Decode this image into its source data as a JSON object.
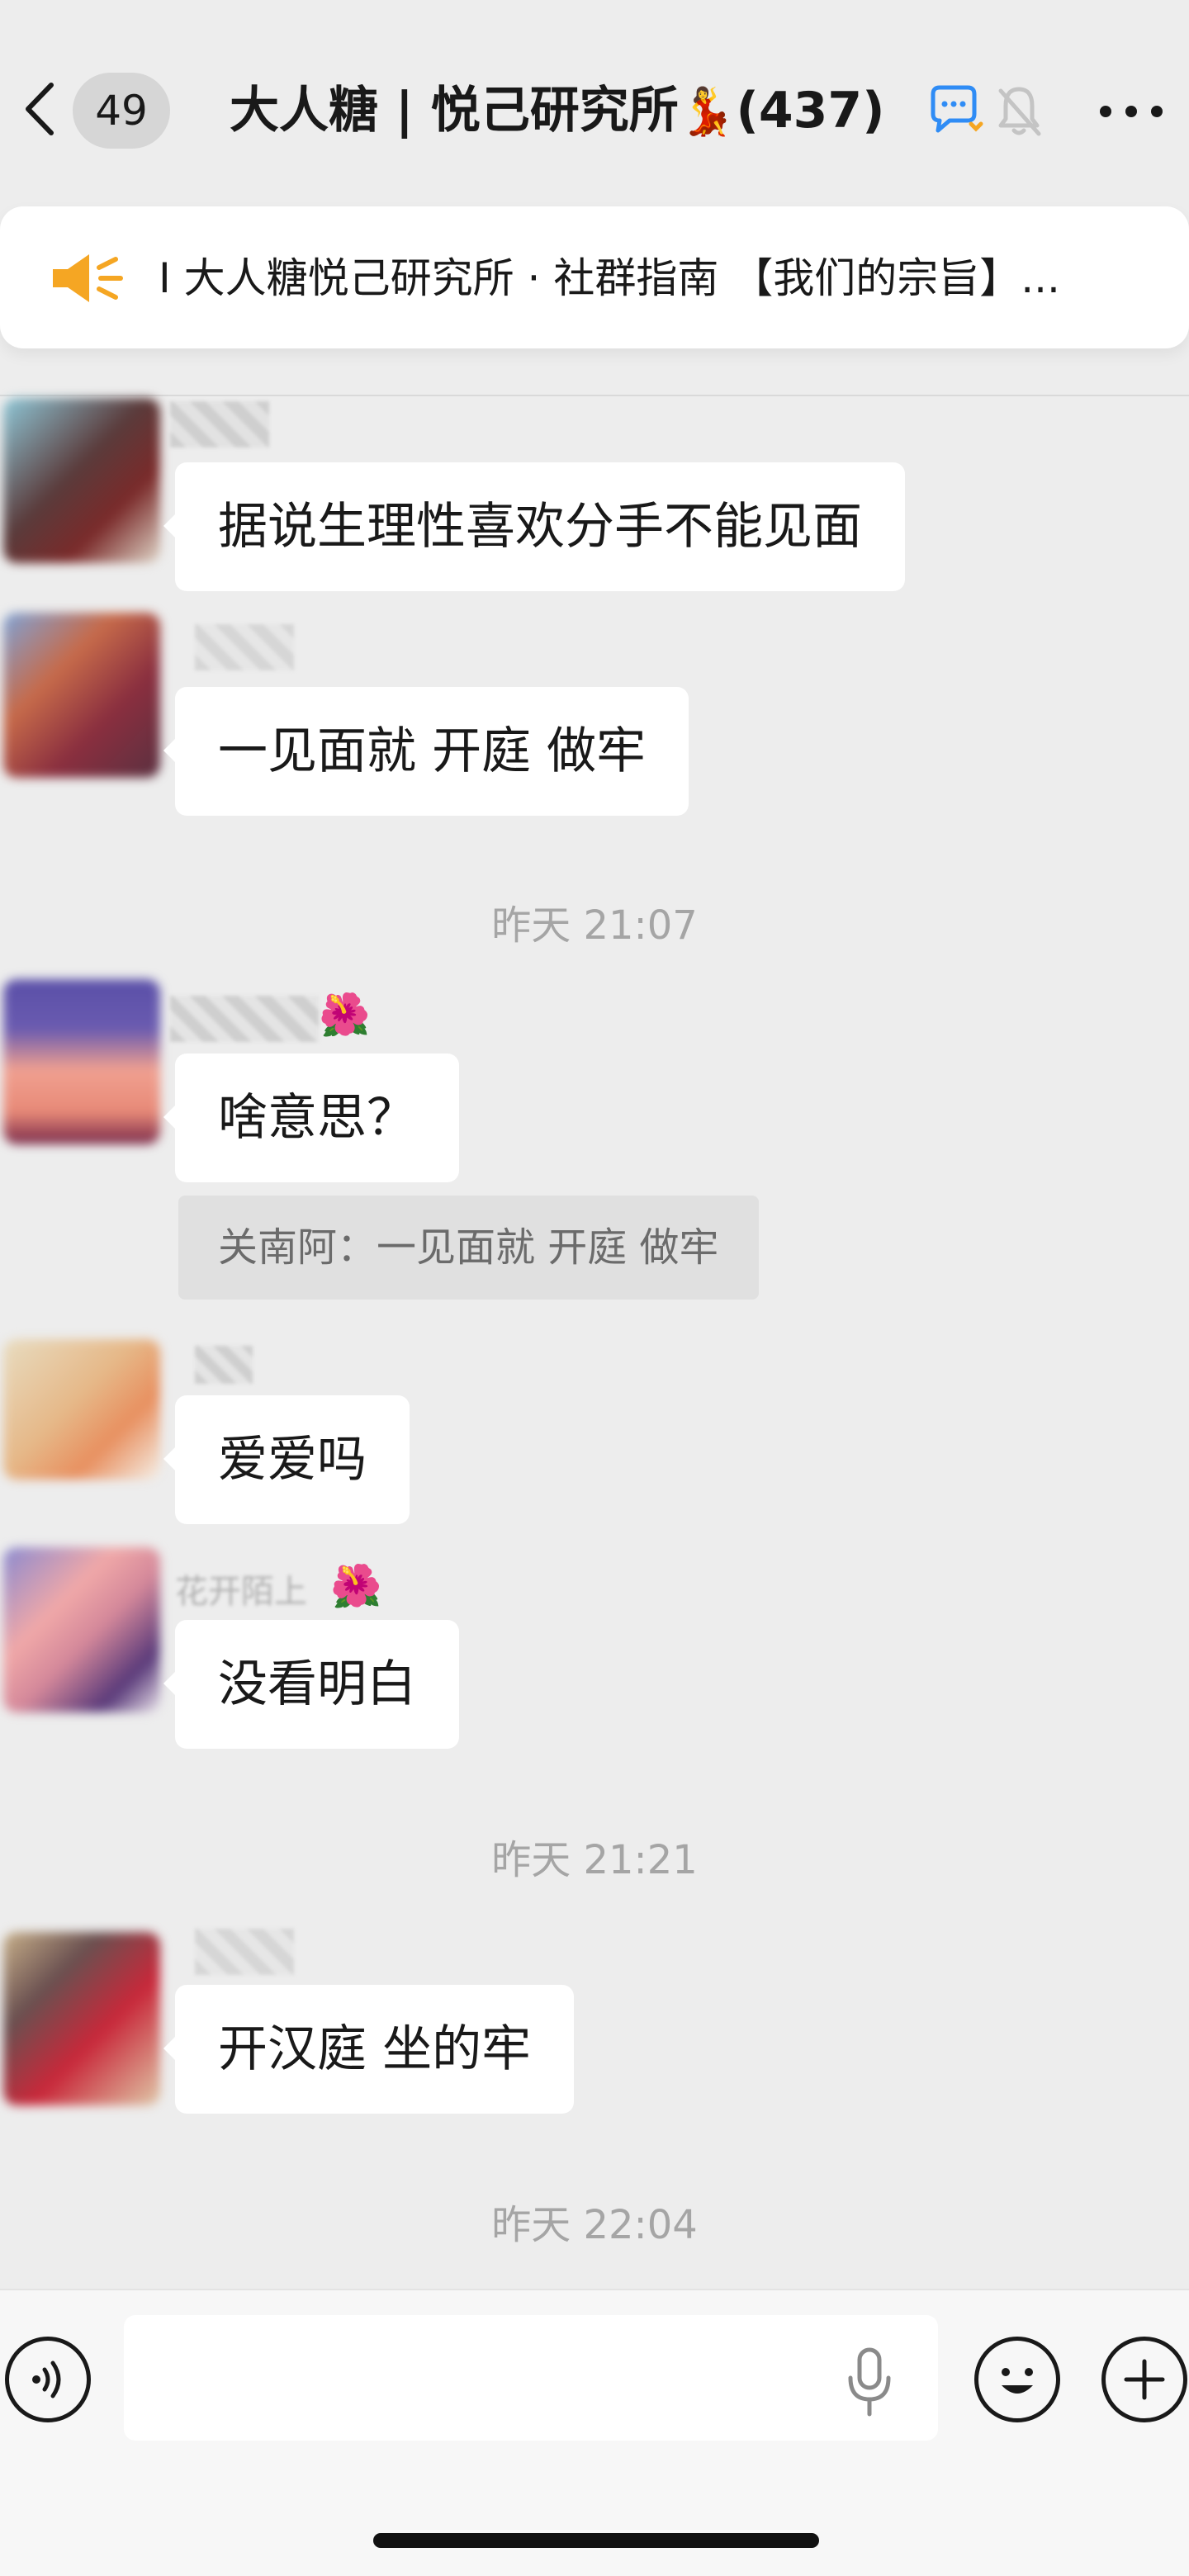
{
  "header": {
    "back_label": "返回",
    "unread_count": "49",
    "title": "大人糖 | 悦己研究所",
    "title_emoji": "💃",
    "member_count": "(437)",
    "icons": [
      "chat-bubble-icon",
      "mute-bell-icon",
      "more-icon"
    ]
  },
  "notice": {
    "icon": "speaker-icon",
    "text": "I 大人糖悦己研究所 · 社群指南 【我们的宗旨】..."
  },
  "messages": [
    {
      "type": "text",
      "sender": "",
      "text": "据说生理性喜欢分手不能见面"
    },
    {
      "type": "text",
      "sender": "",
      "text": "一见面就 开庭 做牢"
    },
    {
      "type": "time",
      "text": "昨天 21:07"
    },
    {
      "type": "text",
      "sender": "",
      "sender_emoji": "🌺",
      "text": "啥意思？"
    },
    {
      "type": "quote",
      "text": "关南阿：一见面就 开庭 做牢"
    },
    {
      "type": "text",
      "sender": "",
      "text": "爱爱吗"
    },
    {
      "type": "text",
      "sender": "花开陌上",
      "sender_emoji": "🌺",
      "text": "没看明白"
    },
    {
      "type": "time",
      "text": "昨天 21:21"
    },
    {
      "type": "text",
      "sender": "",
      "text": "开汉庭 坐的牢"
    },
    {
      "type": "time",
      "text": "昨天 22:04"
    }
  ],
  "input_bar": {
    "icons": [
      "voice-icon",
      "mic-icon",
      "emoji-icon",
      "plus-icon"
    ],
    "value": ""
  },
  "colors": {
    "background": "#ededed",
    "bubble": "#ffffff",
    "notice_icon": "#f5a623",
    "timestamp": "#a5a5a5"
  }
}
